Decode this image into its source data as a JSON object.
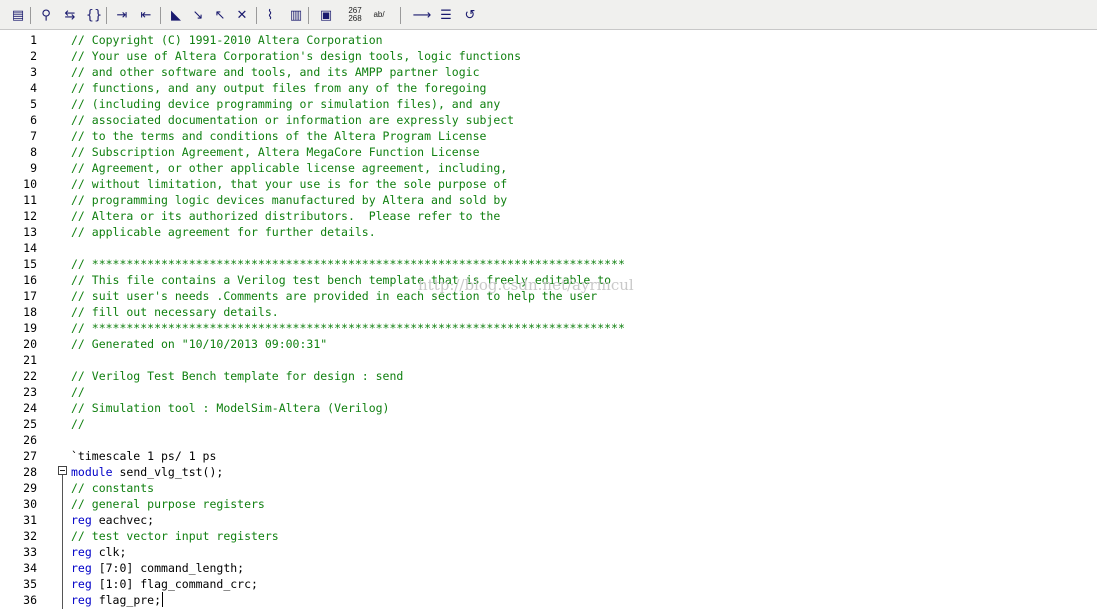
{
  "toolbar": {
    "buttons": [
      {
        "icon": "page-setup-icon",
        "glyph": "▤"
      },
      {
        "icon": "find-icon",
        "glyph": "⚲"
      },
      {
        "icon": "find-replace-icon",
        "glyph": "⇆"
      },
      {
        "icon": "insert-braces-icon",
        "glyph": "{}"
      },
      {
        "icon": "increase-indent-icon",
        "glyph": "⇥"
      },
      {
        "icon": "decrease-indent-icon",
        "glyph": "⇤"
      },
      {
        "icon": "bookmark-icon",
        "glyph": "◣"
      },
      {
        "icon": "next-bookmark-icon",
        "glyph": "↘"
      },
      {
        "icon": "previous-bookmark-icon",
        "glyph": "↖"
      },
      {
        "icon": "clear-bookmarks-icon",
        "glyph": "✕"
      },
      {
        "icon": "attach-icon",
        "glyph": "⌇"
      },
      {
        "icon": "insert-template-icon",
        "glyph": "▥"
      },
      {
        "icon": "insert-file-icon",
        "glyph": "▣"
      },
      {
        "icon": "go-to-line-icon",
        "glyph": "267 268"
      },
      {
        "icon": "replace-text-icon",
        "glyph": "ab/"
      },
      {
        "icon": "comment-block-icon",
        "glyph": "⟶"
      },
      {
        "icon": "uncomment-block-icon",
        "glyph": "☰"
      },
      {
        "icon": "undo-block-icon",
        "glyph": "↺"
      }
    ]
  },
  "colors": {
    "comment": "#108010",
    "keyword": "#0000c8",
    "plain": "#000000",
    "watermark": "#c9c9c9"
  },
  "watermark": "http://blog.csdn.net/ayrmcul",
  "lines": [
    {
      "n": "1",
      "kind": "comment",
      "text": "// Copyright (C) 1991-2010 Altera Corporation"
    },
    {
      "n": "2",
      "kind": "comment",
      "text": "// Your use of Altera Corporation's design tools, logic functions"
    },
    {
      "n": "3",
      "kind": "comment",
      "text": "// and other software and tools, and its AMPP partner logic"
    },
    {
      "n": "4",
      "kind": "comment",
      "text": "// functions, and any output files from any of the foregoing"
    },
    {
      "n": "5",
      "kind": "comment",
      "text": "// (including device programming or simulation files), and any"
    },
    {
      "n": "6",
      "kind": "comment",
      "text": "// associated documentation or information are expressly subject"
    },
    {
      "n": "7",
      "kind": "comment",
      "text": "// to the terms and conditions of the Altera Program License"
    },
    {
      "n": "8",
      "kind": "comment",
      "text": "// Subscription Agreement, Altera MegaCore Function License"
    },
    {
      "n": "9",
      "kind": "comment",
      "text": "// Agreement, or other applicable license agreement, including,"
    },
    {
      "n": "10",
      "kind": "comment",
      "text": "// without limitation, that your use is for the sole purpose of"
    },
    {
      "n": "11",
      "kind": "comment",
      "text": "// programming logic devices manufactured by Altera and sold by"
    },
    {
      "n": "12",
      "kind": "comment",
      "text": "// Altera or its authorized distributors.  Please refer to the"
    },
    {
      "n": "13",
      "kind": "comment",
      "text": "// applicable agreement for further details."
    },
    {
      "n": "14",
      "kind": "plain",
      "text": ""
    },
    {
      "n": "15",
      "kind": "comment",
      "text": "// *****************************************************************************"
    },
    {
      "n": "16",
      "kind": "comment",
      "text": "// This file contains a Verilog test bench template that is freely editable to"
    },
    {
      "n": "17",
      "kind": "comment",
      "text": "// suit user's needs .Comments are provided in each section to help the user"
    },
    {
      "n": "18",
      "kind": "comment",
      "text": "// fill out necessary details."
    },
    {
      "n": "19",
      "kind": "comment",
      "text": "// *****************************************************************************"
    },
    {
      "n": "20",
      "kind": "comment",
      "text": "// Generated on \"10/10/2013 09:00:31\""
    },
    {
      "n": "21",
      "kind": "plain",
      "text": ""
    },
    {
      "n": "22",
      "kind": "comment",
      "text": "// Verilog Test Bench template for design : send"
    },
    {
      "n": "23",
      "kind": "comment",
      "text": "//"
    },
    {
      "n": "24",
      "kind": "comment",
      "text": "// Simulation tool : ModelSim-Altera (Verilog)"
    },
    {
      "n": "25",
      "kind": "comment",
      "text": "//"
    },
    {
      "n": "26",
      "kind": "plain",
      "text": ""
    },
    {
      "n": "27",
      "kind": "plain",
      "text": "`timescale 1 ps/ 1 ps"
    },
    {
      "n": "28",
      "kind": "kw-line",
      "kw": "module",
      "rest": " send_vlg_tst();"
    },
    {
      "n": "29",
      "kind": "comment",
      "text": "// constants"
    },
    {
      "n": "30",
      "kind": "comment",
      "text": "// general purpose registers"
    },
    {
      "n": "31",
      "kind": "kw-line",
      "kw": "reg",
      "rest": " eachvec;"
    },
    {
      "n": "32",
      "kind": "comment",
      "text": "// test vector input registers"
    },
    {
      "n": "33",
      "kind": "kw-line",
      "kw": "reg",
      "rest": " clk;"
    },
    {
      "n": "34",
      "kind": "kw-line",
      "kw": "reg",
      "rest": " [7:0] command_length;"
    },
    {
      "n": "35",
      "kind": "kw-line",
      "kw": "reg",
      "rest": " [1:0] flag_command_crc;"
    },
    {
      "n": "36",
      "kind": "kw-line",
      "kw": "reg",
      "rest": " flag_pre;"
    }
  ]
}
